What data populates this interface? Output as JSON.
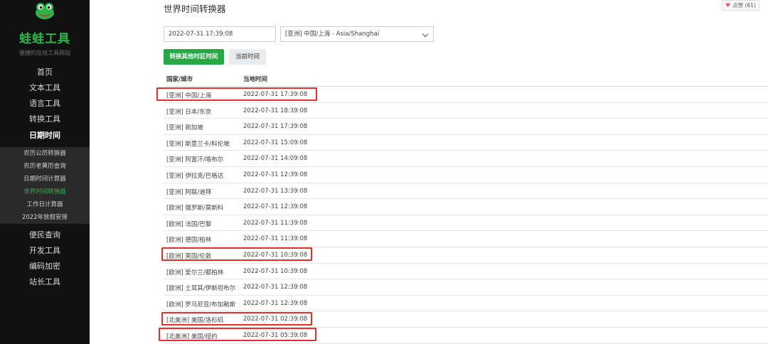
{
  "sidebar": {
    "brand": "蛙蛙工具",
    "tagline": "便捷的在线工具网站",
    "nav_top": [
      "首页",
      "文本工具",
      "语言工具",
      "转换工具",
      "日期时间"
    ],
    "active_section": "日期时间",
    "submenu": [
      "农历公历转换器",
      "农历老黄历查询",
      "日期时间计算器",
      "世界时间转换器",
      "工作日计算器",
      "2022年放假安排"
    ],
    "active_submenu": "世界时间转换器",
    "nav_bottom": [
      "便民查询",
      "开发工具",
      "编码加密",
      "站长工具"
    ]
  },
  "header": {
    "title": "世界时间转换器",
    "like_label": "点赞 (61)"
  },
  "form": {
    "datetime_value": "2022-07-31 17:39:08",
    "timezone_selected": "[亚洲] 中国/上海 - Asia/Shanghai",
    "convert_button": "转换其他时区时间",
    "now_button": "当前时间"
  },
  "table": {
    "headers": [
      "国家/城市",
      "当地时间"
    ],
    "rows": [
      {
        "city": "[亚洲] 中国/上海",
        "time": "2022-07-31 17:39:08"
      },
      {
        "city": "[亚洲] 日本/东京",
        "time": "2022-07-31 18:39:08"
      },
      {
        "city": "[亚洲] 新加坡",
        "time": "2022-07-31 17:39:08"
      },
      {
        "city": "[亚洲] 斯里兰卡/科伦坡",
        "time": "2022-07-31 15:09:08"
      },
      {
        "city": "[亚洲] 阿富汗/喀布尔",
        "time": "2022-07-31 14:09:08"
      },
      {
        "city": "[亚洲] 伊拉克/巴格达",
        "time": "2022-07-31 12:39:08"
      },
      {
        "city": "[亚洲] 阿联/迪拜",
        "time": "2022-07-31 13:39:08"
      },
      {
        "city": "[欧洲] 俄罗斯/莫斯科",
        "time": "2022-07-31 12:39:08"
      },
      {
        "city": "[欧洲] 法国/巴黎",
        "time": "2022-07-31 11:39:08"
      },
      {
        "city": "[欧洲] 德国/柏林",
        "time": "2022-07-31 11:39:08"
      },
      {
        "city": "[欧洲] 英国/伦敦",
        "time": "2022-07-31 10:39:08"
      },
      {
        "city": "[欧洲] 爱尔兰/都柏林",
        "time": "2022-07-31 10:39:08"
      },
      {
        "city": "[欧洲] 土耳其/伊斯坦布尔",
        "time": "2022-07-31 12:39:08"
      },
      {
        "city": "[欧洲] 罗马尼亚/布加勒斯",
        "time": "2022-07-31 12:39:08"
      },
      {
        "city": "[北美洲] 美国/洛杉矶",
        "time": "2022-07-31 02:39:08"
      },
      {
        "city": "[北美洲] 美国/纽约",
        "time": "2022-07-31 05:39:08"
      }
    ]
  },
  "colors": {
    "accent": "#28a745",
    "brand": "#2db34a",
    "highlight": "#e8312f"
  }
}
